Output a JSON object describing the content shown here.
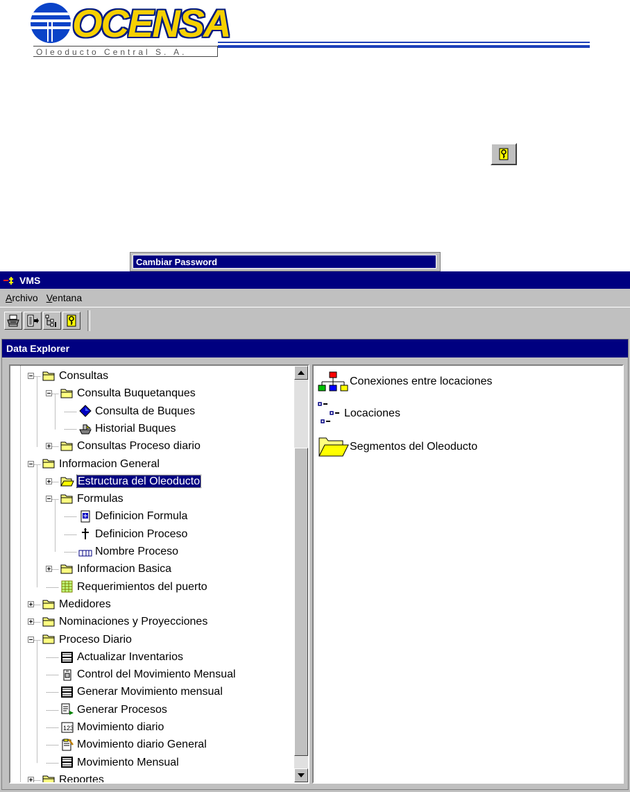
{
  "logo": {
    "name": "OCENSA",
    "subtitle": "Oleoducto Central S. A."
  },
  "tooltip": {
    "text": "Cambiar Password"
  },
  "window": {
    "title": "VMS"
  },
  "menu": [
    {
      "label": "Archivo",
      "accel": "A",
      "rest": "rchivo"
    },
    {
      "label": "Ventana",
      "accel": "V",
      "rest": "entana"
    }
  ],
  "toolbar": {
    "buttons": [
      "printer-icon",
      "exit-door-icon",
      "tree-view-icon",
      "key-icon"
    ]
  },
  "explorer": {
    "title": "Data Explorer",
    "tree": [
      {
        "label": "Consultas",
        "level": 0,
        "icon": "folder-icon",
        "expander": "minus"
      },
      {
        "label": "Consulta Buquetanques",
        "level": 1,
        "icon": "folder-icon",
        "expander": "minus"
      },
      {
        "label": "Consulta de Buques",
        "level": 2,
        "icon": "blue-diamond-icon",
        "expander": "none"
      },
      {
        "label": "Historial Buques",
        "level": 2,
        "icon": "ship-icon",
        "expander": "none"
      },
      {
        "label": "Consultas Proceso diario",
        "level": 1,
        "icon": "folder-icon",
        "expander": "plus"
      },
      {
        "label": "Informacion General",
        "level": 0,
        "icon": "folder-icon",
        "expander": "minus"
      },
      {
        "label": "Estructura del Oleoducto",
        "level": 1,
        "icon": "open-folder-icon",
        "expander": "plus",
        "selected": true
      },
      {
        "label": "Formulas",
        "level": 1,
        "icon": "folder-icon",
        "expander": "minus"
      },
      {
        "label": "Definicion  Formula",
        "level": 2,
        "icon": "formula-doc-icon",
        "expander": "none"
      },
      {
        "label": "Definicion Proceso",
        "level": 2,
        "icon": "process-icon",
        "expander": "none"
      },
      {
        "label": "Nombre Proceso",
        "level": 2,
        "icon": "name-grid-icon",
        "expander": "none"
      },
      {
        "label": "Informacion Basica",
        "level": 1,
        "icon": "folder-icon",
        "expander": "plus"
      },
      {
        "label": "Requerimientos del puerto",
        "level": 1,
        "icon": "grid-sheet-icon",
        "expander": "none"
      },
      {
        "label": "Medidores",
        "level": 0,
        "icon": "folder-icon",
        "expander": "plus"
      },
      {
        "label": "Nominaciones y Proyecciones",
        "level": 0,
        "icon": "folder-icon",
        "expander": "plus"
      },
      {
        "label": "Proceso Diario",
        "level": 0,
        "icon": "folder-icon",
        "expander": "minus"
      },
      {
        "label": "Actualizar Inventarios",
        "level": 1,
        "icon": "table-icon",
        "expander": "none"
      },
      {
        "label": "Control del Movimiento Mensual",
        "level": 1,
        "icon": "control-doc-icon",
        "expander": "none"
      },
      {
        "label": "Generar Movimiento mensual",
        "level": 1,
        "icon": "table-icon",
        "expander": "none"
      },
      {
        "label": "Generar Procesos",
        "level": 1,
        "icon": "generate-icon",
        "expander": "none"
      },
      {
        "label": "Movimiento diario",
        "level": 1,
        "icon": "numbers-icon",
        "expander": "none"
      },
      {
        "label": "Movimiento diario General",
        "level": 1,
        "icon": "edit-doc-icon",
        "expander": "none"
      },
      {
        "label": "Movimiento Mensual",
        "level": 1,
        "icon": "table-icon",
        "expander": "none"
      },
      {
        "label": "Reportes",
        "level": 0,
        "icon": "folder-icon",
        "expander": "plus"
      }
    ],
    "list": [
      {
        "label": "Conexiones entre locaciones",
        "icon": "network-icon"
      },
      {
        "label": "Locaciones",
        "icon": "locations-icon"
      },
      {
        "label": "Segmentos del Oleoducto",
        "icon": "open-folder-large-icon"
      }
    ]
  },
  "colors": {
    "titlebar": "#000080",
    "face": "#c0c0c0",
    "folder": "#ffff80",
    "logo_blue": "#0a43c8",
    "logo_yellow": "#f6d000"
  }
}
